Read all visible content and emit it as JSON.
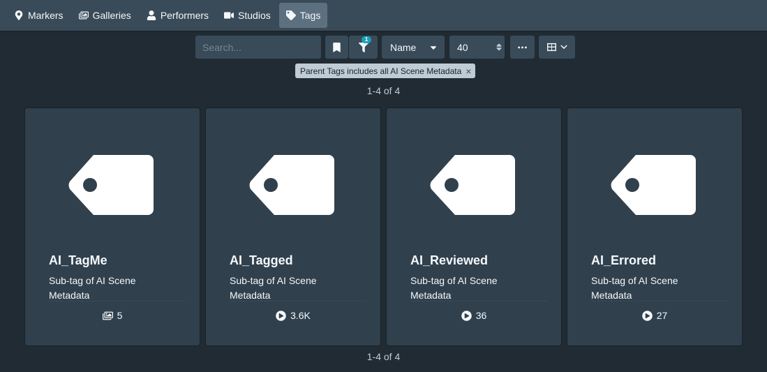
{
  "nav": {
    "items": [
      {
        "label": "Markers",
        "icon": "map-marker-icon"
      },
      {
        "label": "Galleries",
        "icon": "images-icon"
      },
      {
        "label": "Performers",
        "icon": "user-icon"
      },
      {
        "label": "Studios",
        "icon": "video-icon"
      },
      {
        "label": "Tags",
        "icon": "tag-icon",
        "active": true
      }
    ]
  },
  "toolbar": {
    "search_placeholder": "Search...",
    "filter_count": "1",
    "sort_label": "Name",
    "per_page": "40",
    "more_label": "···"
  },
  "filter": {
    "label": "Parent Tags includes all AI Scene Metadata",
    "remove": "×"
  },
  "pagination": {
    "top": "1-4 of 4",
    "bottom": "1-4 of 4"
  },
  "cards": [
    {
      "title": "AI_TagMe",
      "description": "Sub-tag of AI Scene Metadata",
      "count": "5",
      "count_icon": "images-icon"
    },
    {
      "title": "AI_Tagged",
      "description": "Sub-tag of AI Scene Metadata",
      "count": "3.6K",
      "count_icon": "play-circle-icon"
    },
    {
      "title": "AI_Reviewed",
      "description": "Sub-tag of AI Scene Metadata",
      "count": "36",
      "count_icon": "play-circle-icon"
    },
    {
      "title": "AI_Errored",
      "description": "Sub-tag of AI Scene Metadata",
      "count": "27",
      "count_icon": "play-circle-icon"
    }
  ],
  "colors": {
    "background": "#202b33",
    "navbar": "#394b59",
    "card": "#30404d",
    "badge": "#17a2b8",
    "filter_tag": "#bfccd6"
  }
}
